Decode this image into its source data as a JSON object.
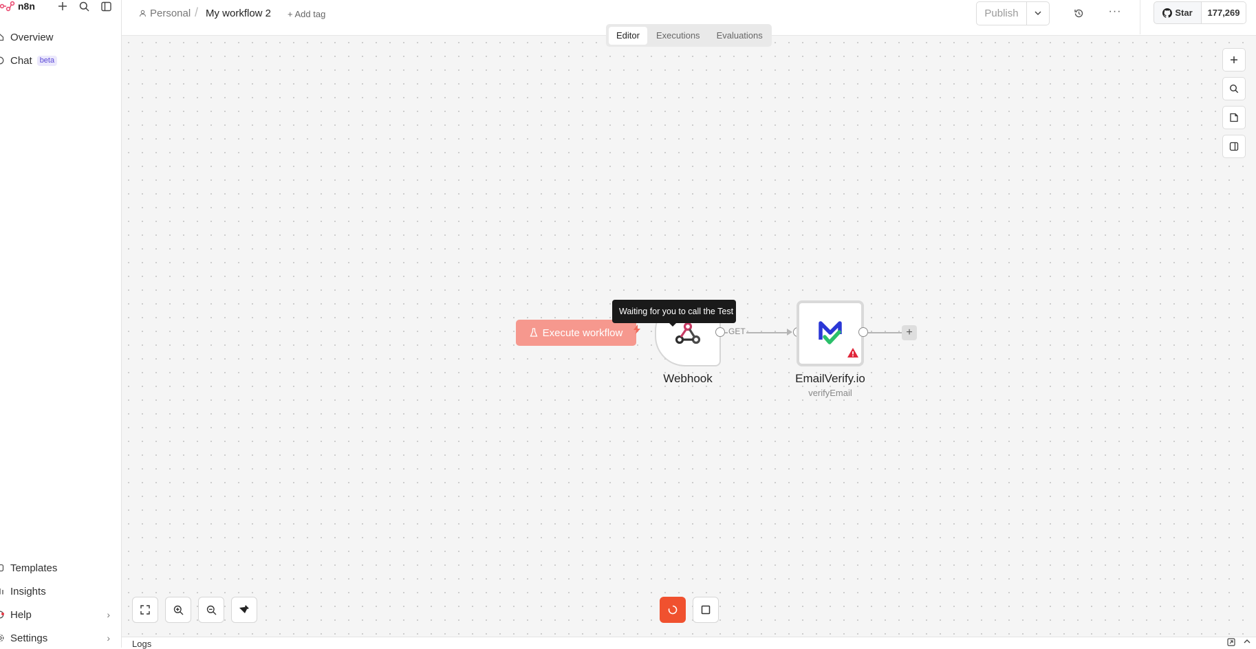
{
  "app": {
    "name": "n8n",
    "brand_color": "#ea4b71"
  },
  "sidebar": {
    "items_top": [
      {
        "label": "Overview",
        "icon": "home-icon"
      },
      {
        "label": "Chat",
        "badge": "beta",
        "icon": "chat-icon"
      }
    ],
    "items_bottom": [
      {
        "label": "Templates",
        "icon": "templates-icon"
      },
      {
        "label": "Insights",
        "icon": "insights-icon"
      },
      {
        "label": "Help",
        "icon": "help-icon",
        "has_submenu": true,
        "notification_dot": true
      },
      {
        "label": "Settings",
        "icon": "settings-icon",
        "has_submenu": true
      }
    ]
  },
  "header": {
    "breadcrumb_project": "Personal",
    "breadcrumb_separator": "/",
    "workflow_name": "My workflow 2",
    "add_tag": "+ Add tag",
    "publish_label": "Publish",
    "github": {
      "star_label": "Star",
      "star_count": "177,269"
    }
  },
  "tabs": [
    {
      "label": "Editor",
      "active": true
    },
    {
      "label": "Executions",
      "active": false
    },
    {
      "label": "Evaluations",
      "active": false
    }
  ],
  "canvas": {
    "execute_button": "Execute workflow",
    "tooltip": "Waiting for you to call the Test URL",
    "nodes": [
      {
        "name": "Webhook",
        "type": "trigger",
        "icon": "webhook-icon"
      },
      {
        "name": "EmailVerify.io",
        "subtitle": "verifyEmail",
        "icon": "emailverify-logo",
        "warning": true
      }
    ],
    "connection_label": "GET",
    "accent_color": "#f0512f"
  },
  "logs": {
    "label": "Logs"
  }
}
